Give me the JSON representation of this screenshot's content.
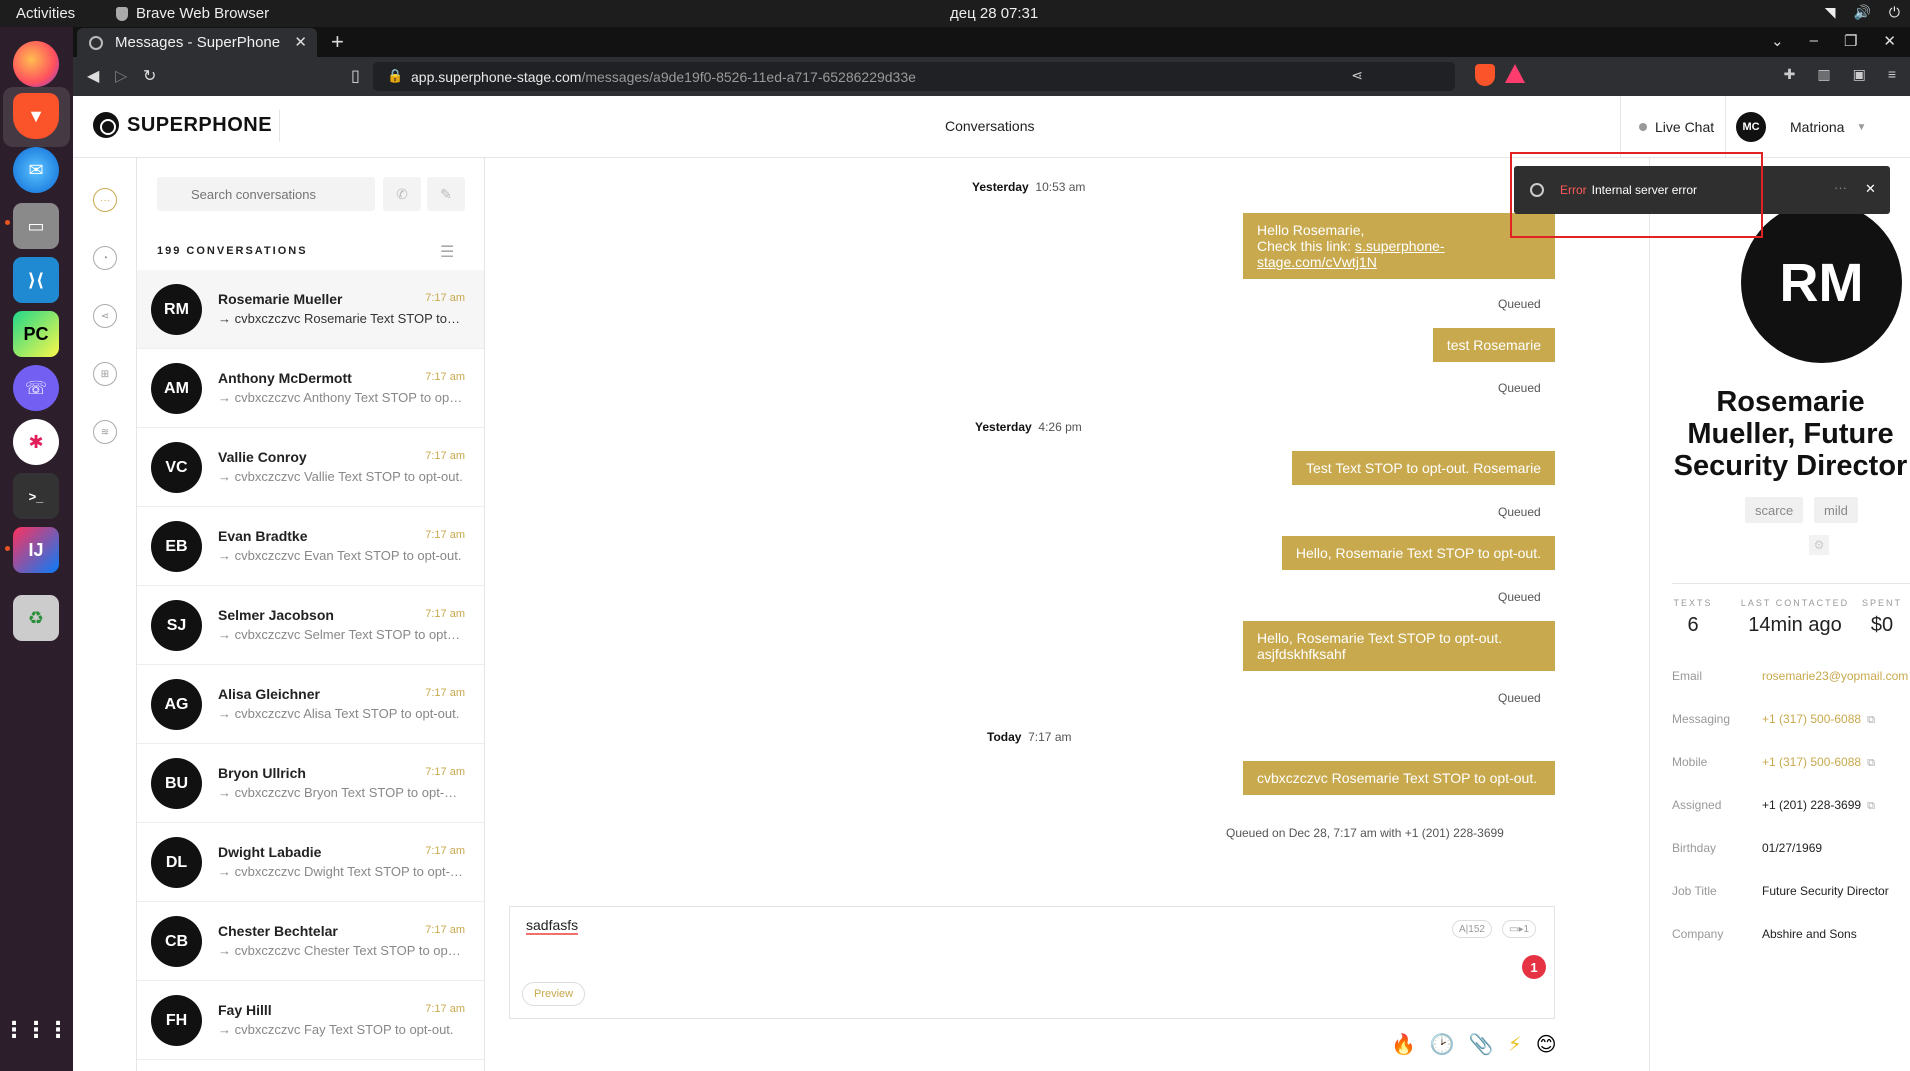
{
  "os": {
    "activities": "Activities",
    "app_name": "Brave Web Browser",
    "clock": "дец 28  07:31"
  },
  "browser": {
    "tab_title": "Messages - SuperPhone",
    "url_host": "app.superphone-stage.com",
    "url_path": "/messages/a9de19f0-8526-11ed-a717-65286229d33e"
  },
  "header": {
    "logo": "SUPERPHONE",
    "title": "Conversations",
    "live_chat": "Live Chat",
    "user_initials": "MC",
    "user_name": "Matriona"
  },
  "sidebar": {
    "search_placeholder": "Search conversations",
    "count_label": "199 CONVERSATIONS",
    "conversations": [
      {
        "initials": "RM",
        "name": "Rosemarie Mueller",
        "time": "7:17 am",
        "preview": "→ cvbxczczvc Rosemarie Text STOP to opt-out."
      },
      {
        "initials": "AM",
        "name": "Anthony McDermott",
        "time": "7:17 am",
        "preview": "→ cvbxczczvc Anthony Text STOP to opt-out."
      },
      {
        "initials": "VC",
        "name": "Vallie Conroy",
        "time": "7:17 am",
        "preview": "→ cvbxczczvc Vallie Text STOP to opt-out."
      },
      {
        "initials": "EB",
        "name": "Evan Bradtke",
        "time": "7:17 am",
        "preview": "→ cvbxczczvc Evan Text STOP to opt-out."
      },
      {
        "initials": "SJ",
        "name": "Selmer Jacobson",
        "time": "7:17 am",
        "preview": "→ cvbxczczvc Selmer Text STOP to opt-out."
      },
      {
        "initials": "AG",
        "name": "Alisa Gleichner",
        "time": "7:17 am",
        "preview": "→ cvbxczczvc Alisa Text STOP to opt-out."
      },
      {
        "initials": "BU",
        "name": "Bryon Ullrich",
        "time": "7:17 am",
        "preview": "→ cvbxczczvc Bryon Text STOP to opt-out."
      },
      {
        "initials": "DL",
        "name": "Dwight Labadie",
        "time": "7:17 am",
        "preview": "→ cvbxczczvc Dwight Text STOP to opt-out."
      },
      {
        "initials": "CB",
        "name": "Chester Bechtelar",
        "time": "7:17 am",
        "preview": "→ cvbxczczvc Chester Text STOP to opt-out."
      },
      {
        "initials": "FH",
        "name": "Fay Hilll",
        "time": "7:17 am",
        "preview": "→ cvbxczczvc Fay Text STOP to opt-out."
      }
    ]
  },
  "thread": {
    "day1_label": "Yesterday",
    "day1_time": "10:53 am",
    "msg1_line1": "Hello Rosemarie,",
    "msg1_line2_prefix": "Check this link: ",
    "msg1_link": "s.superphone-stage.com/cVwtj1N",
    "msg2": "test Rosemarie",
    "day2_label": "Yesterday",
    "day2_time": "4:26 pm",
    "msg3": "Test Text STOP to opt-out. Rosemarie",
    "msg4": "Hello, Rosemarie Text STOP to opt-out.",
    "msg5": "Hello, Rosemarie Text STOP to opt-out. asjfdskhfksahf",
    "day3_label": "Today",
    "day3_time": "7:17 am",
    "msg6": "cvbxczczvc Rosemarie Text STOP to opt-out.",
    "status_queued": "Queued",
    "last_status": "Queued on Dec 28, 7:17 am with +1 (201) 228-3699",
    "composer_text": "sadfasfs",
    "char_count": "A|152",
    "segments": "1",
    "badge": "1",
    "preview_label": "Preview"
  },
  "contact": {
    "initials": "RM",
    "name": "Rosemarie Mueller, Future Security Director",
    "tags": [
      "scarce",
      "mild"
    ],
    "stats": {
      "texts_label": "TEXTS",
      "texts": "6",
      "last_label": "LAST CONTACTED",
      "last": "14min ago",
      "spent_label": "SPENT",
      "spent": "$0"
    },
    "fields": [
      {
        "label": "Email",
        "value": "rosemarie23@yopmail.com"
      },
      {
        "label": "Messaging",
        "value": "+1 (317) 500-6088"
      },
      {
        "label": "Mobile",
        "value": "+1 (317) 500-6088"
      },
      {
        "label": "Assigned",
        "value": "+1 (201) 228-3699"
      },
      {
        "label": "Birthday",
        "value": "01/27/1969"
      },
      {
        "label": "Job Title",
        "value": "Future Security Director"
      },
      {
        "label": "Company",
        "value": "Abshire and Sons"
      }
    ]
  },
  "toast": {
    "error_label": "Error",
    "message": "Internal server error"
  },
  "colors": {
    "accent": "#c8a94e",
    "error": "#e02222"
  }
}
